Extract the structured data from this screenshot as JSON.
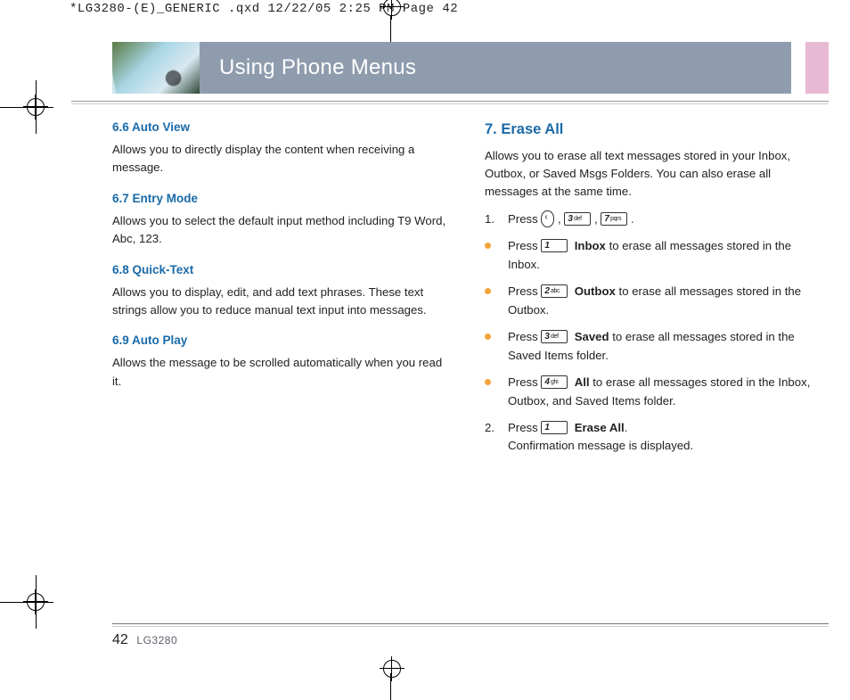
{
  "file_header": "*LG3280-(E)_GENERIC .qxd  12/22/05  2:25 PM  Page 42",
  "banner_title": "Using Phone Menus",
  "left_column": {
    "s66_title": "6.6 Auto View",
    "s66_body": "Allows you to directly display the content when receiving a message.",
    "s67_title": "6.7 Entry Mode",
    "s67_body": "Allows you to select the default input method including T9 Word, Abc, 123.",
    "s68_title": "6.8 Quick-Text",
    "s68_body": "Allows you to display, edit, and add text phrases. These text strings allow you to reduce manual text input into messages.",
    "s69_title": "6.9 Auto Play",
    "s69_body": "Allows the message to be scrolled automatically when you read it."
  },
  "right_column": {
    "main_title": "7. Erase All",
    "intro": "Allows you to erase all text messages stored in your Inbox, Outbox, or Saved Msgs Folders. You can also erase all messages at the same time.",
    "step1_num": "1.",
    "step1_a": "Press ",
    "step1_b": " , ",
    "step1_c": " , ",
    "step1_d": " .",
    "inbox_a": "Press ",
    "inbox_bold": "Inbox",
    "inbox_b": " to erase all messages stored in the Inbox.",
    "outbox_a": "Press ",
    "outbox_bold": "Outbox",
    "outbox_b": " to erase all messages stored in the Outbox.",
    "saved_a": "Press ",
    "saved_bold": "Saved",
    "saved_b": " to erase all messages stored in the Saved Items folder.",
    "all_a": "Press ",
    "all_bold": "All",
    "all_b": " to erase all messages stored in the Inbox, Outbox, and Saved Items folder.",
    "step2_num": "2.",
    "step2_a": "Press ",
    "step2_bold": "Erase All",
    "step2_b": ".",
    "step2_c": "Confirmation message is displayed."
  },
  "keys": {
    "k1n": "1",
    "k1l": "",
    "k2n": "2",
    "k2l": "abc",
    "k3n": "3",
    "k3l": "def",
    "k4n": "4",
    "k4l": "ghi",
    "k7n": "7",
    "k7l": "pqrs"
  },
  "footer": {
    "page": "42",
    "model": "LG3280"
  }
}
